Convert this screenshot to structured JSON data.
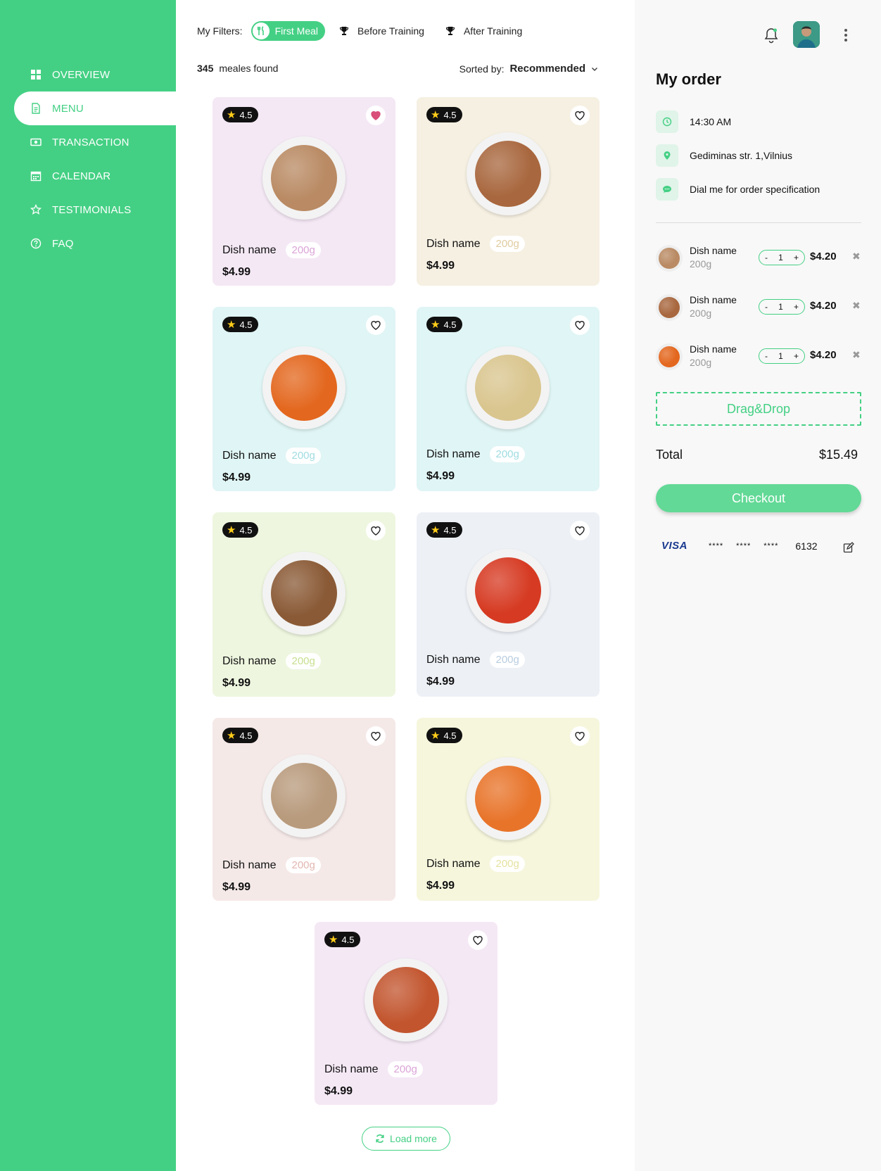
{
  "sidebar": {
    "items": [
      {
        "label": "OVERVIEW",
        "icon": "grid-icon"
      },
      {
        "label": "MENU",
        "icon": "document-icon"
      },
      {
        "label": "TRANSACTION",
        "icon": "money-icon"
      },
      {
        "label": "CALENDAR",
        "icon": "calendar-icon"
      },
      {
        "label": "TESTIMONIALS",
        "icon": "star-icon"
      },
      {
        "label": "FAQ",
        "icon": "question-icon"
      }
    ],
    "active": "MENU"
  },
  "filters": {
    "label": "My Filters:",
    "chips": [
      {
        "label": "First Meal",
        "icon": "cutlery-icon",
        "active": true
      },
      {
        "label": "Before Training",
        "icon": "trophy-icon",
        "active": false
      },
      {
        "label": "After Training",
        "icon": "trophy-icon",
        "active": false
      }
    ]
  },
  "results": {
    "count": "345",
    "text": "meales found"
  },
  "sort": {
    "label": "Sorted by:",
    "value": "Recommended"
  },
  "cards": [
    {
      "rating": "4.5",
      "name": "Dish name",
      "weight": "200g",
      "price": "$4.99",
      "favorite": true,
      "bg": "#f4e8f5",
      "food_color": "#b98a63",
      "weight_color": "#dba4d8"
    },
    {
      "rating": "4.5",
      "name": "Dish name",
      "weight": "200g",
      "price": "$4.99",
      "favorite": false,
      "bg": "#f6f0e2",
      "food_color": "#a8673e",
      "weight_color": "#e0cca0"
    },
    {
      "rating": "4.5",
      "name": "Dish name",
      "weight": "200g",
      "price": "$4.99",
      "favorite": false,
      "bg": "#e0f5f5",
      "food_color": "#e3671e",
      "weight_color": "#a0dce2"
    },
    {
      "rating": "4.5",
      "name": "Dish name",
      "weight": "200g",
      "price": "$4.99",
      "favorite": false,
      "bg": "#e0f5f5",
      "food_color": "#d9c58e",
      "weight_color": "#a0dce2"
    },
    {
      "rating": "4.5",
      "name": "Dish name",
      "weight": "200g",
      "price": "$4.99",
      "favorite": false,
      "bg": "#eef6df",
      "food_color": "#8a5a36",
      "weight_color": "#c7e08e"
    },
    {
      "rating": "4.5",
      "name": "Dish name",
      "weight": "200g",
      "price": "$4.99",
      "favorite": false,
      "bg": "#edf1f6",
      "food_color": "#d63a22",
      "weight_color": "#b9cde0"
    },
    {
      "rating": "4.5",
      "name": "Dish name",
      "weight": "200g",
      "price": "$4.99",
      "favorite": false,
      "bg": "#f5e9e8",
      "food_color": "#b89a7c",
      "weight_color": "#e3b7b1"
    },
    {
      "rating": "4.5",
      "name": "Dish name",
      "weight": "200g",
      "price": "$4.99",
      "favorite": false,
      "bg": "#f6f6dd",
      "food_color": "#e8742a",
      "weight_color": "#e6e2a0"
    },
    {
      "rating": "4.5",
      "name": "Dish name",
      "weight": "200g",
      "price": "$4.99",
      "favorite": false,
      "bg": "#f4e8f5",
      "food_color": "#c2552e",
      "weight_color": "#dba4d8"
    }
  ],
  "load_more": "Load more",
  "order": {
    "title": "My order",
    "time": "14:30 AM",
    "address": "Gediminas str. 1,Vilnius",
    "note": "Dial me for order specification",
    "items": [
      {
        "name": "Dish name",
        "weight": "200g",
        "qty": "1",
        "price": "$4.20",
        "food_color": "#b98a63"
      },
      {
        "name": "Dish name",
        "weight": "200g",
        "qty": "1",
        "price": "$4.20",
        "food_color": "#a8673e"
      },
      {
        "name": "Dish name",
        "weight": "200g",
        "qty": "1",
        "price": "$4.20",
        "food_color": "#e3671e"
      }
    ],
    "drop_label": "Drag&Drop",
    "total_label": "Total",
    "total_value": "$15.49",
    "checkout_label": "Checkout",
    "payment": {
      "brand": "VISA",
      "mask": [
        "****",
        "****",
        "****"
      ],
      "last4": "6132"
    }
  },
  "colors": {
    "accent": "#44d084",
    "checkout": "#62d996",
    "heart_active": "#d94f7a"
  }
}
